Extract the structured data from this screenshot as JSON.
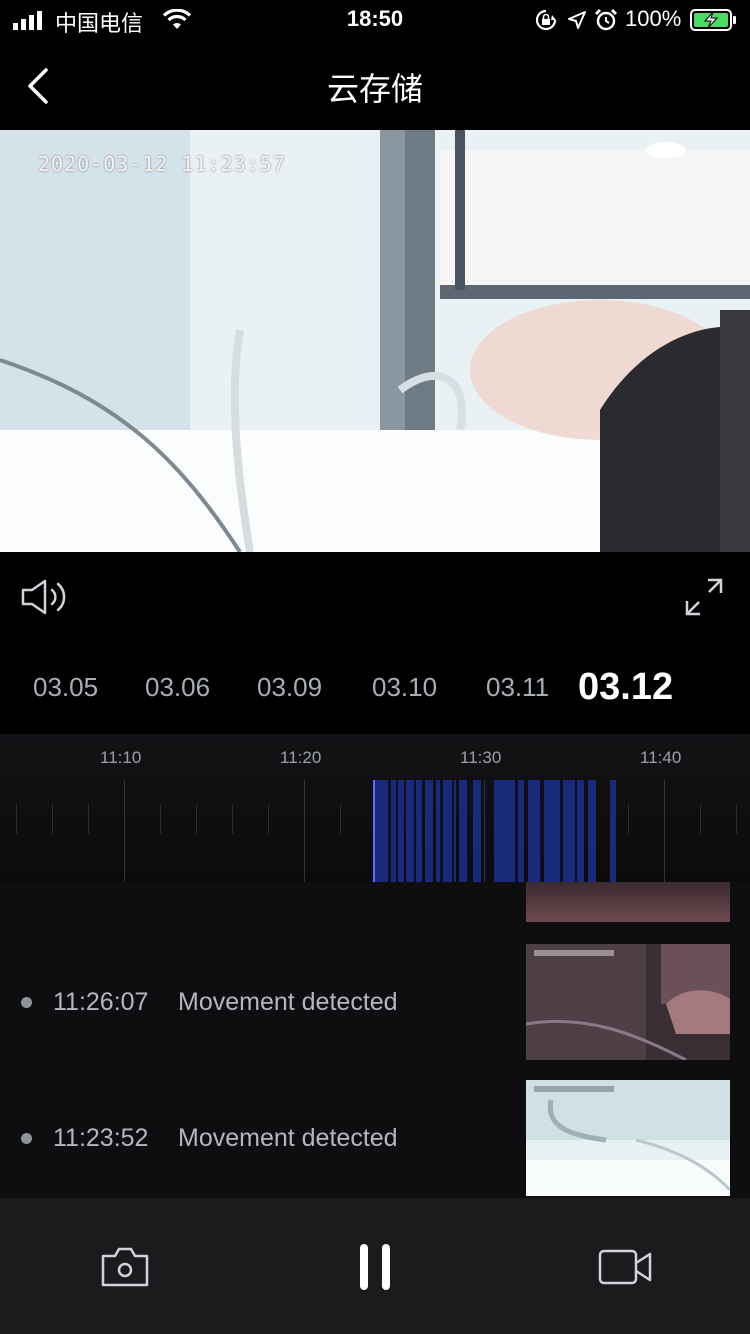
{
  "status_bar": {
    "carrier": "中国电信",
    "time": "18:50",
    "battery": "100%",
    "icons": [
      "signal-icon",
      "wifi-icon",
      "orientation-lock-icon",
      "location-icon",
      "alarm-icon",
      "battery-charging-icon"
    ]
  },
  "nav": {
    "title": "云存储",
    "back_icon": "chevron-left-icon"
  },
  "video": {
    "timestamp": "2020-03-12 11:23:57"
  },
  "controls": {
    "volume_icon": "speaker-icon",
    "fullscreen_icon": "expand-icon"
  },
  "dates": [
    "03.05",
    "03.06",
    "03.09",
    "03.10",
    "03.11",
    "03.12"
  ],
  "selected_date": "03.12",
  "timeline": {
    "labels": [
      "11:10",
      "11:20",
      "11:30",
      "11:40"
    ],
    "recorded_color": "#1a2a7a",
    "cursor_color": "#5b6cff"
  },
  "events": [
    {
      "time": "11:26:07",
      "label": "Movement detected"
    },
    {
      "time": "11:23:52",
      "label": "Movement detected"
    }
  ],
  "bottom_bar": {
    "icons": [
      "camera-icon",
      "pause-icon",
      "video-camera-icon"
    ]
  }
}
